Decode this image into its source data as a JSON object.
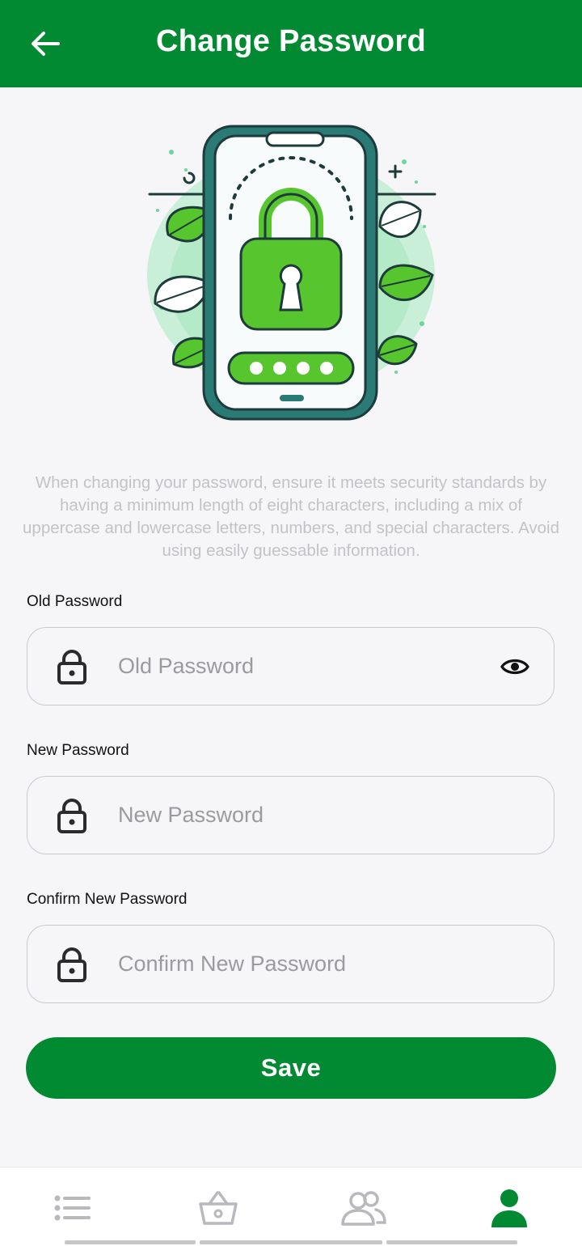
{
  "header": {
    "title": "Change Password",
    "back_icon": "arrow-left-icon"
  },
  "colors": {
    "brand": "#028a33",
    "background": "#f6f6f9",
    "hint_text": "#c3c3c7",
    "placeholder": "#9a9a9f"
  },
  "hero": {
    "icon": "phone-padlock-illustration",
    "pin_dots": 4
  },
  "description": "When changing your password, ensure it meets security standards by having a minimum length of eight characters, including a mix of uppercase and lowercase letters, numbers, and special characters. Avoid using easily guessable information.",
  "form": {
    "old_password": {
      "label": "Old Password",
      "placeholder": "Old Password",
      "value": "",
      "icon": "lock-icon",
      "toggle_icon": "eye-icon"
    },
    "new_password": {
      "label": "New Password",
      "placeholder": "New Password",
      "value": "",
      "icon": "lock-icon"
    },
    "confirm_password": {
      "label": "Confirm New Password",
      "placeholder": "Confirm New Password",
      "value": "",
      "icon": "lock-icon"
    },
    "save_label": "Save"
  },
  "bottom_nav": {
    "items": [
      {
        "icon": "list-icon",
        "active": false
      },
      {
        "icon": "basket-icon",
        "active": false
      },
      {
        "icon": "people-icon",
        "active": false
      },
      {
        "icon": "profile-icon",
        "active": true
      }
    ]
  }
}
